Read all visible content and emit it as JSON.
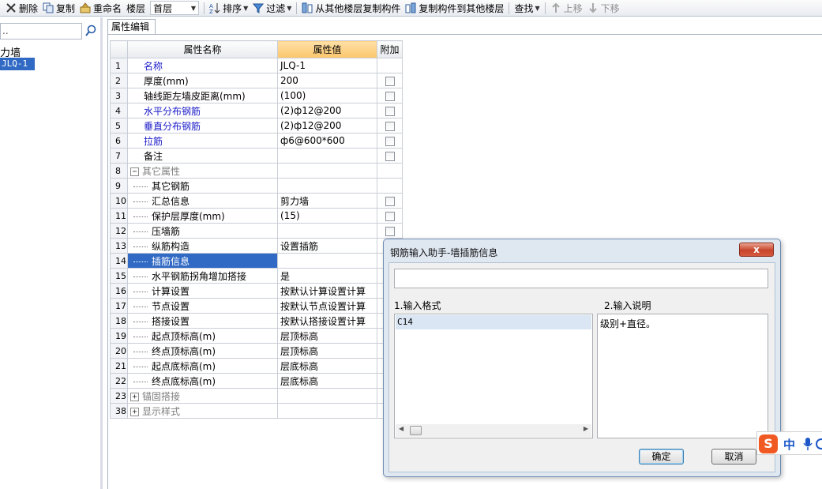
{
  "toolbar": {
    "delete": "删除",
    "copy": "复制",
    "rename": "重命名",
    "floor_label": "楼层",
    "floor_value": "首层",
    "sort": "排序",
    "filter": "过滤",
    "copy_from_floor": "从其他楼层复制构件",
    "copy_to_floor": "复制构件到其他楼层",
    "find": "查找",
    "move_up": "上移",
    "move_down": "下移"
  },
  "tree": {
    "search_value": "..",
    "root": "力墙",
    "child": "JLQ-1"
  },
  "prop_tab": "属性编辑",
  "table": {
    "headers": {
      "name": "属性名称",
      "value": "属性值",
      "extra": "附加"
    },
    "rows": [
      {
        "num": "1",
        "name": "名称",
        "value": "JLQ-1"
      },
      {
        "num": "2",
        "name": "厚度(mm)",
        "value": "200"
      },
      {
        "num": "3",
        "name": "轴线距左墙皮距离(mm)",
        "value": "(100)"
      },
      {
        "num": "4",
        "name": "水平分布钢筋",
        "value": "(2)ф12@200"
      },
      {
        "num": "5",
        "name": "垂直分布钢筋",
        "value": "(2)ф12@200"
      },
      {
        "num": "6",
        "name": "拉筋",
        "value": "ф6@600*600"
      },
      {
        "num": "7",
        "name": "备注",
        "value": ""
      },
      {
        "num": "8",
        "name": "其它属性",
        "value": ""
      },
      {
        "num": "9",
        "name": "其它钢筋",
        "value": ""
      },
      {
        "num": "10",
        "name": "汇总信息",
        "value": "剪力墙"
      },
      {
        "num": "11",
        "name": "保护层厚度(mm)",
        "value": "(15)"
      },
      {
        "num": "12",
        "name": "压墙筋",
        "value": ""
      },
      {
        "num": "13",
        "name": "纵筋构造",
        "value": "设置插筋"
      },
      {
        "num": "14",
        "name": "插筋信息",
        "value": ""
      },
      {
        "num": "15",
        "name": "水平钢筋拐角增加搭接",
        "value": "是"
      },
      {
        "num": "16",
        "name": "计算设置",
        "value": "按默认计算设置计算"
      },
      {
        "num": "17",
        "name": "节点设置",
        "value": "按默认节点设置计算"
      },
      {
        "num": "18",
        "name": "搭接设置",
        "value": "按默认搭接设置计算"
      },
      {
        "num": "19",
        "name": "起点顶标高(m)",
        "value": "层顶标高"
      },
      {
        "num": "20",
        "name": "终点顶标高(m)",
        "value": "层顶标高"
      },
      {
        "num": "21",
        "name": "起点底标高(m)",
        "value": "层底标高"
      },
      {
        "num": "22",
        "name": "终点底标高(m)",
        "value": "层底标高"
      },
      {
        "num": "23",
        "name": "锚固搭接",
        "value": ""
      },
      {
        "num": "38",
        "name": "显示样式",
        "value": ""
      }
    ]
  },
  "dialog": {
    "title": "钢筋输入助手-墙插筋信息",
    "close": "x",
    "input_value": "",
    "format_label": "1.输入格式",
    "description_label": "2.输入说明",
    "format_item": "C14",
    "description": "级别+直径。",
    "ok": "确定",
    "cancel": "取消"
  },
  "ime": {
    "logo": "S",
    "lang": "中"
  },
  "colors": {
    "selection_blue": "#316ac5",
    "link_blue": "#1b1bc9",
    "header_orange": "#fbc66a",
    "ime_orange": "#f05a22"
  }
}
